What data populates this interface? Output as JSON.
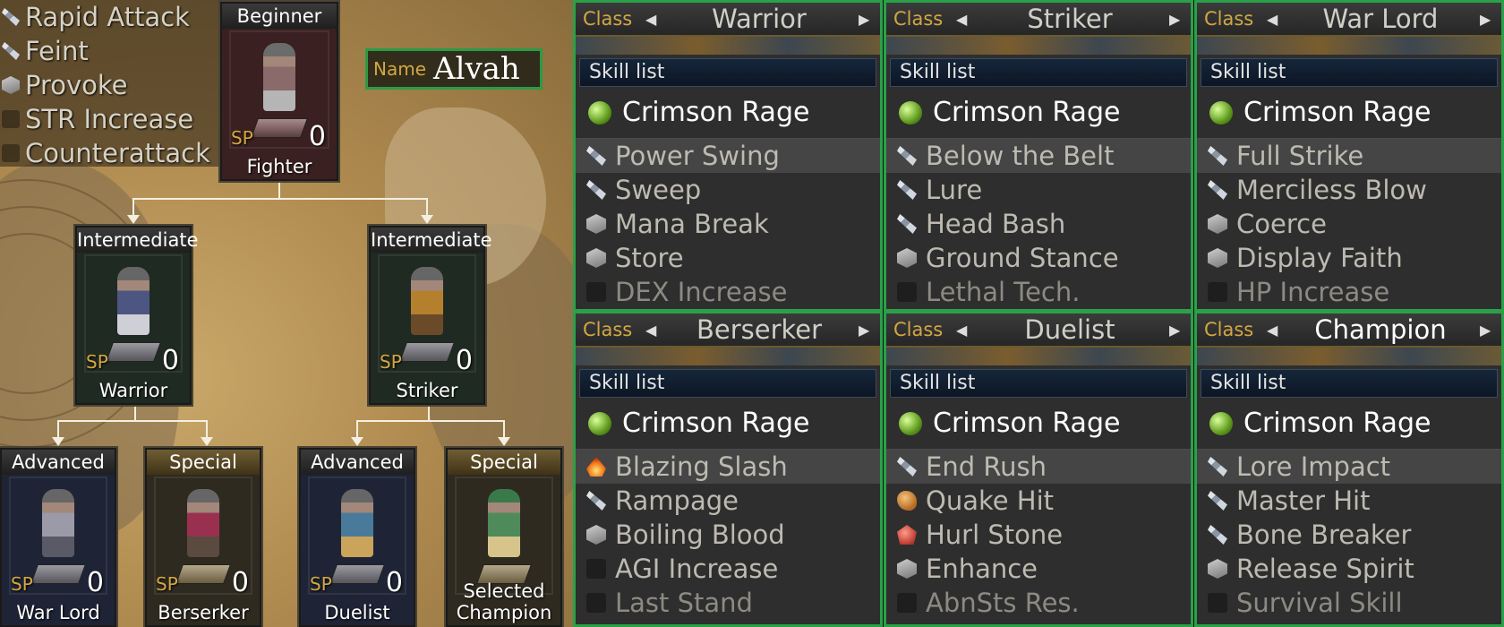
{
  "top_skills": [
    {
      "icon": "sword",
      "label": "Rapid Attack"
    },
    {
      "icon": "sword",
      "label": "Feint"
    },
    {
      "icon": "cube",
      "label": "Provoke"
    },
    {
      "icon": "blank",
      "label": "STR Increase"
    },
    {
      "icon": "blank",
      "label": "Counterattack"
    }
  ],
  "name": {
    "key": "Name",
    "value": "Alvah"
  },
  "tree": {
    "fighter": {
      "rank": "Beginner",
      "sp_label": "SP",
      "sp": "0",
      "cls": "Fighter"
    },
    "warrior": {
      "rank": "Intermediate",
      "sp_label": "SP",
      "sp": "0",
      "cls": "Warrior"
    },
    "striker": {
      "rank": "Intermediate",
      "sp_label": "SP",
      "sp": "0",
      "cls": "Striker"
    },
    "warlord": {
      "rank": "Advanced",
      "sp_label": "SP",
      "sp": "0",
      "cls": "War Lord"
    },
    "berserker": {
      "rank": "Special",
      "sp_label": "SP",
      "sp": "0",
      "cls": "Berserker"
    },
    "duelist": {
      "rank": "Advanced",
      "sp_label": "SP",
      "sp": "0",
      "cls": "Duelist"
    },
    "champion": {
      "rank": "Special",
      "selected": "Selected",
      "cls": "Champion"
    }
  },
  "panels": [
    {
      "class_key": "Class",
      "class_name": "Warrior",
      "skill_list": "Skill list",
      "equipped": "Crimson Rage",
      "skills": [
        {
          "icon": "sword",
          "label": "Power Swing"
        },
        {
          "icon": "sword",
          "label": "Sweep"
        },
        {
          "icon": "cube",
          "label": "Mana Break"
        },
        {
          "icon": "cube",
          "label": "Store"
        },
        {
          "icon": "blank",
          "label": "DEX Increase"
        }
      ]
    },
    {
      "class_key": "Class",
      "class_name": "Striker",
      "skill_list": "Skill list",
      "equipped": "Crimson Rage",
      "skills": [
        {
          "icon": "sword",
          "label": "Below the Belt"
        },
        {
          "icon": "sword",
          "label": "Lure"
        },
        {
          "icon": "sword",
          "label": "Head Bash"
        },
        {
          "icon": "cube",
          "label": "Ground Stance"
        },
        {
          "icon": "blank",
          "label": "Lethal Tech."
        }
      ]
    },
    {
      "class_key": "Class",
      "class_name": "War Lord",
      "skill_list": "Skill list",
      "equipped": "Crimson Rage",
      "skills": [
        {
          "icon": "sword",
          "label": "Full Strike"
        },
        {
          "icon": "sword",
          "label": "Merciless Blow"
        },
        {
          "icon": "cube",
          "label": "Coerce"
        },
        {
          "icon": "cube",
          "label": "Display Faith"
        },
        {
          "icon": "blank",
          "label": "HP Increase"
        }
      ]
    },
    {
      "class_key": "Class",
      "class_name": "Berserker",
      "skill_list": "Skill list",
      "equipped": "Crimson Rage",
      "skills": [
        {
          "icon": "fire",
          "label": "Blazing Slash"
        },
        {
          "icon": "sword",
          "label": "Rampage"
        },
        {
          "icon": "cube",
          "label": "Boiling Blood"
        },
        {
          "icon": "blank",
          "label": "AGI Increase"
        },
        {
          "icon": "blank",
          "label": "Last Stand"
        }
      ]
    },
    {
      "class_key": "Class",
      "class_name": "Duelist",
      "skill_list": "Skill list",
      "equipped": "Crimson Rage",
      "skills": [
        {
          "icon": "sword",
          "label": "End Rush"
        },
        {
          "icon": "boulder",
          "label": "Quake Hit"
        },
        {
          "icon": "hurl",
          "label": "Hurl Stone"
        },
        {
          "icon": "cube",
          "label": "Enhance"
        },
        {
          "icon": "blank",
          "label": "AbnSts Res."
        }
      ]
    },
    {
      "class_key": "Class",
      "class_name": "Champion",
      "skill_list": "Skill list",
      "equipped": "Crimson Rage",
      "skills": [
        {
          "icon": "sword",
          "label": "Lore Impact"
        },
        {
          "icon": "sword",
          "label": "Master Hit"
        },
        {
          "icon": "sword",
          "label": "Bone Breaker"
        },
        {
          "icon": "cube",
          "label": "Release Spirit"
        },
        {
          "icon": "blank",
          "label": "Survival Skill"
        }
      ]
    }
  ],
  "colors": {
    "accent_green": "#2aa148",
    "sp_gold": "#d3a742"
  }
}
